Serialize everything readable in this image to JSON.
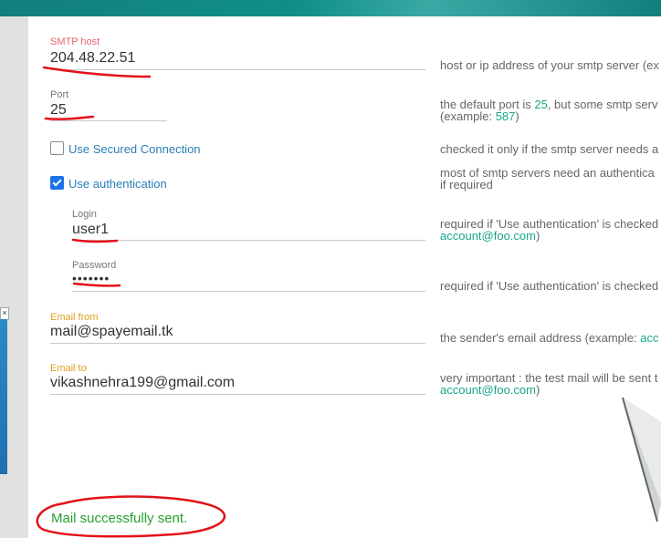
{
  "fields": {
    "smtp_host": {
      "label": "SMTP host",
      "value": "204.48.22.51",
      "hint": "host or ip address of your smtp server (ex"
    },
    "port": {
      "label": "Port",
      "value": "25",
      "hint_line1_prefix": "the default port is ",
      "hint_line1_port": "25",
      "hint_line1_suffix": ", but some smtp serv",
      "hint_line2_prefix": "(example: ",
      "hint_line2_port": "587",
      "hint_line2_suffix": ")"
    },
    "login": {
      "label": "Login",
      "value": "user1",
      "hint_line1": "required if 'Use authentication' is checked",
      "hint_line2_link": "account@foo.com",
      "hint_line2_suffix": ")"
    },
    "password": {
      "label": "Password",
      "value": "•••••••",
      "hint": "required if 'Use authentication' is checked"
    },
    "email_from": {
      "label": "Email from",
      "value": "mail@spayemail.tk",
      "hint_prefix": "the sender's email address (example: ",
      "hint_link": "acc"
    },
    "email_to": {
      "label": "Email to",
      "value": "vikashnehra199@gmail.com",
      "hint_line1": "very important : the test mail will be sent t",
      "hint_line2_link": "account@foo.com",
      "hint_line2_suffix": ")"
    }
  },
  "options": {
    "secured": {
      "label": "Use Secured Connection",
      "checked": false,
      "hint": "checked it only if the smtp server needs a"
    },
    "auth": {
      "label": "Use authentication",
      "checked": true,
      "hint_line1": "most of smtp servers need an authentica",
      "hint_line2": "if required"
    }
  },
  "status": {
    "message": "Mail successfully sent."
  },
  "sidebar": {
    "close_glyph": "×"
  },
  "annotation_color": "#e3121a",
  "colors": {
    "accent_teal": "#1aa58a",
    "link_blue": "#2a7db5",
    "success_green": "#27a030",
    "label_amber": "#e0a020",
    "label_red": "#e8636e"
  }
}
